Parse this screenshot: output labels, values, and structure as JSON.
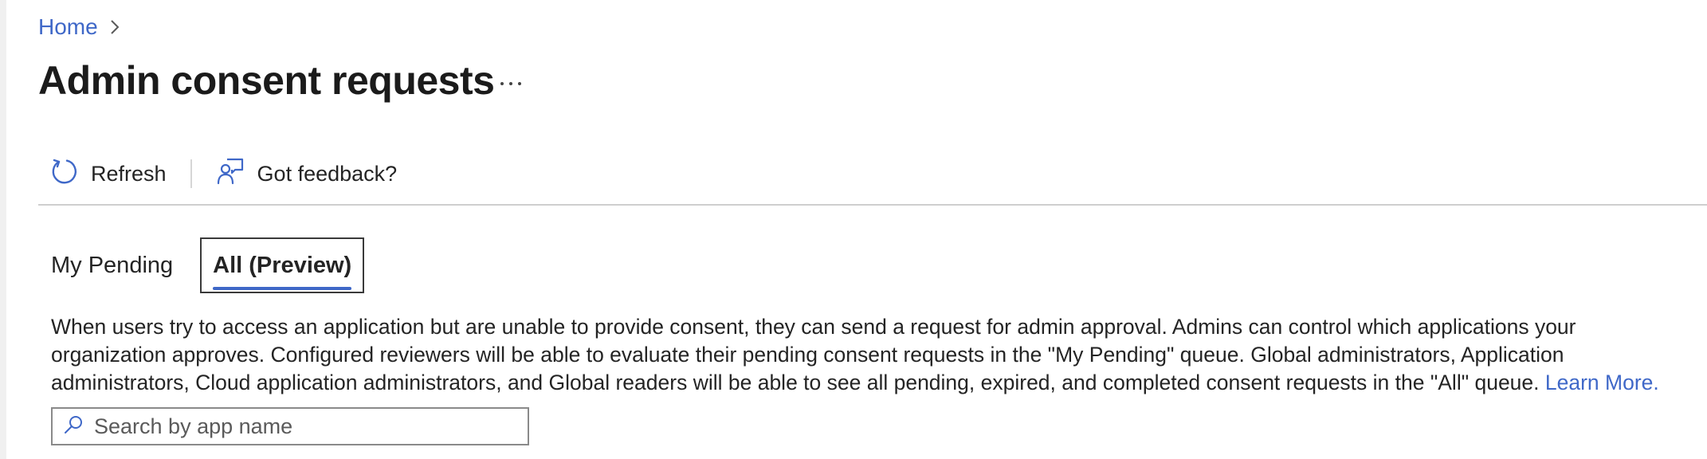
{
  "breadcrumb": {
    "home_label": "Home"
  },
  "page": {
    "title": "Admin consent requests",
    "more_label": "···"
  },
  "toolbar": {
    "refresh_label": "Refresh",
    "feedback_label": "Got feedback?"
  },
  "tabs": [
    {
      "label": "My Pending",
      "selected": false
    },
    {
      "label": "All (Preview)",
      "selected": true
    }
  ],
  "description": {
    "text": "When users try to access an application but are unable to provide consent, they can send a request for admin approval. Admins can control which applications your organization approves. Configured reviewers will be able to evaluate their pending consent requests in the \"My Pending\" queue. Global administrators, Application administrators, Cloud application administrators, and Global readers will be able to see all pending, expired, and completed consent requests in the \"All\" queue. ",
    "link_label": "Learn More."
  },
  "search": {
    "placeholder": "Search by app name",
    "value": ""
  },
  "colors": {
    "accent": "#3f68c8",
    "text": "#242424",
    "divider": "#cfcfcf"
  },
  "icons": [
    "chevron-right-icon",
    "more-icon",
    "refresh-icon",
    "feedback-icon",
    "search-icon"
  ]
}
